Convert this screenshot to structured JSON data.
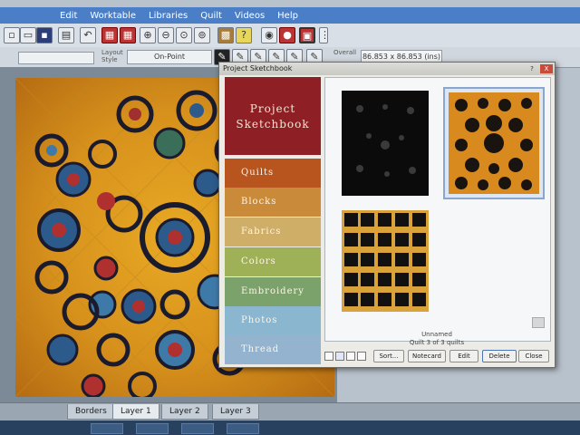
{
  "menu": [
    "Edit",
    "Worktable",
    "Libraries",
    "Quilt",
    "Videos",
    "Help"
  ],
  "toolbar": {
    "layout_label_1": "Layout",
    "layout_label_2": "Style",
    "layout_value": "On-Point",
    "overall_label": "Overall",
    "overall_value": "86.853 x 86.853 (ins)"
  },
  "dialog": {
    "title": "Project Sketchbook",
    "close": "X",
    "help": "?",
    "header_line1": "Project",
    "header_line2": "Sketchbook",
    "categories": [
      {
        "label": "Quilts",
        "color": "#b8541e"
      },
      {
        "label": "Blocks",
        "color": "#c98a3a"
      },
      {
        "label": "Fabrics",
        "color": "#cfae67"
      },
      {
        "label": "Colors",
        "color": "#9fb157"
      },
      {
        "label": "Embroidery",
        "color": "#7ba26b"
      },
      {
        "label": "Photos",
        "color": "#8ab6cf"
      },
      {
        "label": "Thread",
        "color": "#93b3cf"
      }
    ],
    "caption_name": "Unnamed",
    "caption_count": "Quilt 3 of 3 quilts",
    "buttons": {
      "sort": "Sort...",
      "notecard": "Notecard",
      "edit": "Edit",
      "delete": "Delete",
      "close": "Close"
    }
  },
  "tabs": [
    "Borders",
    "Layer 1",
    "Layer 2",
    "Layer 3"
  ]
}
